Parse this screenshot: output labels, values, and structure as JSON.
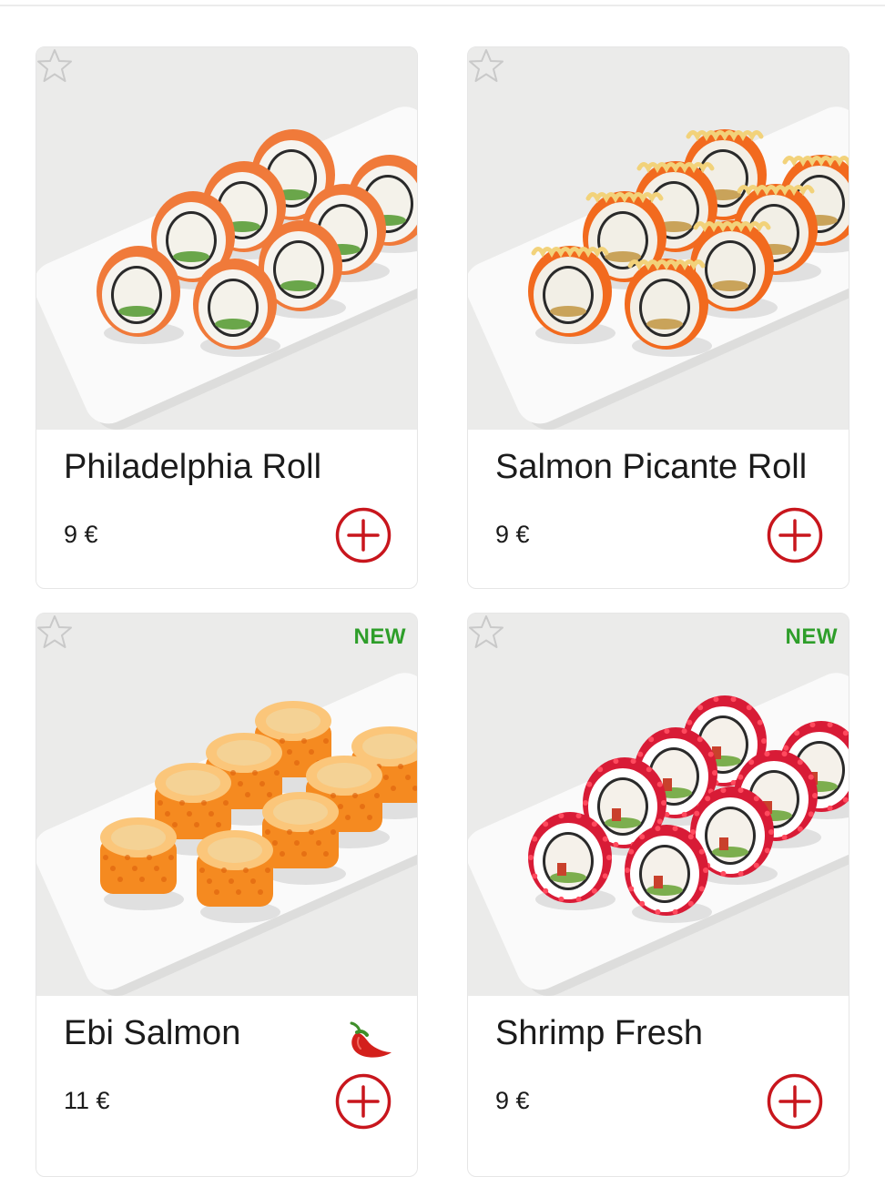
{
  "products": [
    {
      "name": "Philadelphia Roll",
      "price": "9 €",
      "badge": "",
      "spicy": false,
      "favorite_icon": "star-outline-icon",
      "add_icon": "plus-circle-icon",
      "roll_style": "salmon",
      "colors": {
        "outer": "#f07a3a",
        "rice": "#f6f4ef",
        "center": "#f4f2ea",
        "filling": "#6aa64a"
      }
    },
    {
      "name": "Salmon Picante Roll",
      "price": "9 €",
      "badge": "",
      "spicy": false,
      "favorite_icon": "star-outline-icon",
      "add_icon": "plus-circle-icon",
      "roll_style": "picante",
      "colors": {
        "outer": "#f26a1e",
        "rice": "#f3efe6",
        "center": "#f2efe6",
        "filling": "#c9a35a"
      }
    },
    {
      "name": "Ebi Salmon",
      "price": "11 €",
      "badge": "",
      "spicy": true,
      "favorite_icon": "star-outline-icon",
      "add_icon": "plus-circle-icon",
      "roll_style": "baked",
      "colors": {
        "outer": "#f58a20",
        "rice": "#f9b24a",
        "center": "#fbc67a",
        "filling": "#f3d59c"
      }
    },
    {
      "name": "Shrimp Fresh",
      "price": "9 €",
      "badge": "NEW",
      "spicy": false,
      "favorite_icon": "star-outline-icon",
      "add_icon": "plus-circle-icon",
      "roll_style": "tobiko",
      "colors": {
        "outer": "#d81b36",
        "rice": "#ffffff",
        "center": "#f5f1ea",
        "filling": "#7cae4e"
      }
    }
  ],
  "badge_ebi": "NEW",
  "theme": {
    "accent": "#c8161d",
    "badge_green": "#2e9e2a",
    "star_gray": "#c9c9c9"
  }
}
